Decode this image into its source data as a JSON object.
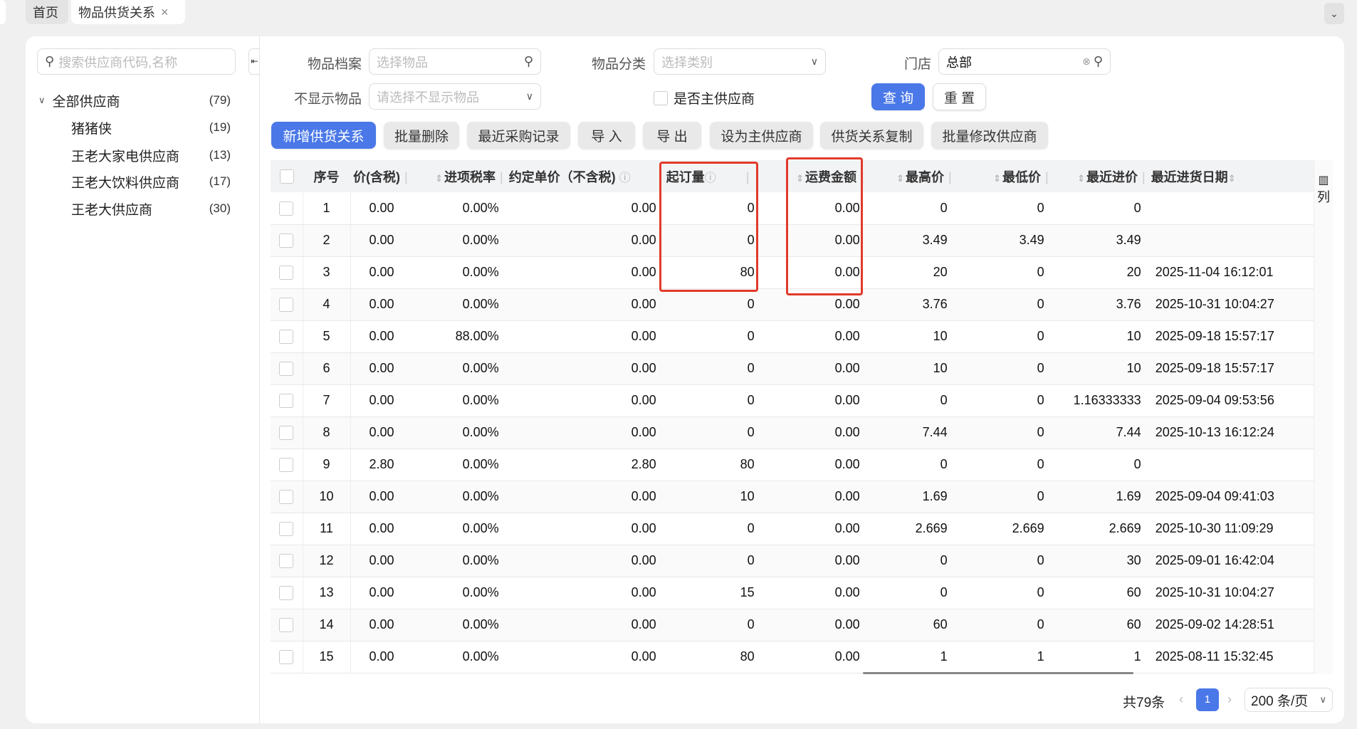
{
  "tabs": [
    {
      "label": "首页"
    },
    {
      "label": "物品供货关系",
      "close": "×"
    }
  ],
  "sidebar": {
    "search_placeholder": "搜索供应商代码,名称",
    "tree": [
      {
        "label": "全部供应商",
        "count": "(79)"
      },
      {
        "label": "猪猪侠",
        "count": "(19)"
      },
      {
        "label": "王老大家电供应商",
        "count": "(13)"
      },
      {
        "label": "王老大饮料供应商",
        "count": "(17)"
      },
      {
        "label": "王老大供应商",
        "count": "(30)"
      }
    ]
  },
  "filters": {
    "item_label": "物品档案",
    "item_placeholder": "选择物品",
    "category_label": "物品分类",
    "category_placeholder": "选择类别",
    "store_label": "门店",
    "store_value": "总部",
    "hide_label": "不显示物品",
    "hide_placeholder": "请选择不显示物品",
    "main_supplier_label": "是否主供应商",
    "query": "查 询",
    "reset": "重 置"
  },
  "toolbar": [
    "新增供货关系",
    "批量删除",
    "最近采购记录",
    "导 入",
    "导 出",
    "设为主供应商",
    "供货关系复制",
    "批量修改供应商"
  ],
  "table": {
    "headers": [
      "序号",
      "价(含税)",
      "进项税率",
      "约定单价（不含税)",
      "起订量",
      "运费金额",
      "最高价",
      "最低价",
      "最近进价",
      "最近进货日期"
    ],
    "column_settings": "列",
    "rows": [
      [
        "1",
        "0.00",
        "0.00%",
        "0.00",
        "0",
        "0.00",
        "0",
        "0",
        "0",
        ""
      ],
      [
        "2",
        "0.00",
        "0.00%",
        "0.00",
        "0",
        "0.00",
        "3.49",
        "3.49",
        "3.49",
        ""
      ],
      [
        "3",
        "0.00",
        "0.00%",
        "0.00",
        "80",
        "0.00",
        "20",
        "0",
        "20",
        "2025-11-04 16:12:01"
      ],
      [
        "4",
        "0.00",
        "0.00%",
        "0.00",
        "0",
        "0.00",
        "3.76",
        "0",
        "3.76",
        "2025-10-31 10:04:27"
      ],
      [
        "5",
        "0.00",
        "88.00%",
        "0.00",
        "0",
        "0.00",
        "10",
        "0",
        "10",
        "2025-09-18 15:57:17"
      ],
      [
        "6",
        "0.00",
        "0.00%",
        "0.00",
        "0",
        "0.00",
        "10",
        "0",
        "10",
        "2025-09-18 15:57:17"
      ],
      [
        "7",
        "0.00",
        "0.00%",
        "0.00",
        "0",
        "0.00",
        "0",
        "0",
        "1.16333333",
        "2025-09-04 09:53:56"
      ],
      [
        "8",
        "0.00",
        "0.00%",
        "0.00",
        "0",
        "0.00",
        "7.44",
        "0",
        "7.44",
        "2025-10-13 16:12:24"
      ],
      [
        "9",
        "2.80",
        "0.00%",
        "2.80",
        "80",
        "0.00",
        "0",
        "0",
        "0",
        ""
      ],
      [
        "10",
        "0.00",
        "0.00%",
        "0.00",
        "10",
        "0.00",
        "1.69",
        "0",
        "1.69",
        "2025-09-04 09:41:03"
      ],
      [
        "11",
        "0.00",
        "0.00%",
        "0.00",
        "0",
        "0.00",
        "2.669",
        "2.669",
        "2.669",
        "2025-10-30 11:09:29"
      ],
      [
        "12",
        "0.00",
        "0.00%",
        "0.00",
        "0",
        "0.00",
        "0",
        "0",
        "30",
        "2025-09-01 16:42:04"
      ],
      [
        "13",
        "0.00",
        "0.00%",
        "0.00",
        "15",
        "0.00",
        "0",
        "0",
        "60",
        "2025-10-31 10:04:27"
      ],
      [
        "14",
        "0.00",
        "0.00%",
        "0.00",
        "0",
        "0.00",
        "60",
        "0",
        "60",
        "2025-09-02 14:28:51"
      ],
      [
        "15",
        "0.00",
        "0.00%",
        "0.00",
        "80",
        "0.00",
        "1",
        "1",
        "1",
        "2025-08-11 15:32:45"
      ]
    ]
  },
  "pagination": {
    "total": "共79条",
    "current": "1",
    "page_size": "200 条/页"
  },
  "colors": {
    "primary": "#4a78e8",
    "highlight": "#e23a2a"
  }
}
